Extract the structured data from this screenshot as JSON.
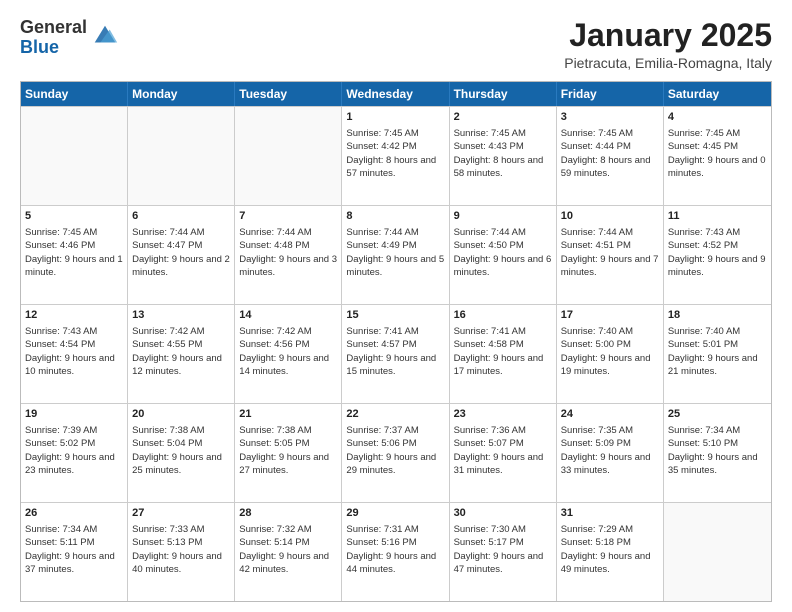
{
  "header": {
    "logo_general": "General",
    "logo_blue": "Blue",
    "title": "January 2025",
    "subtitle": "Pietracuta, Emilia-Romagna, Italy"
  },
  "weekdays": [
    "Sunday",
    "Monday",
    "Tuesday",
    "Wednesday",
    "Thursday",
    "Friday",
    "Saturday"
  ],
  "weeks": [
    [
      {
        "date": "",
        "info": ""
      },
      {
        "date": "",
        "info": ""
      },
      {
        "date": "",
        "info": ""
      },
      {
        "date": "1",
        "info": "Sunrise: 7:45 AM\nSunset: 4:42 PM\nDaylight: 8 hours and 57 minutes."
      },
      {
        "date": "2",
        "info": "Sunrise: 7:45 AM\nSunset: 4:43 PM\nDaylight: 8 hours and 58 minutes."
      },
      {
        "date": "3",
        "info": "Sunrise: 7:45 AM\nSunset: 4:44 PM\nDaylight: 8 hours and 59 minutes."
      },
      {
        "date": "4",
        "info": "Sunrise: 7:45 AM\nSunset: 4:45 PM\nDaylight: 9 hours and 0 minutes."
      }
    ],
    [
      {
        "date": "5",
        "info": "Sunrise: 7:45 AM\nSunset: 4:46 PM\nDaylight: 9 hours and 1 minute."
      },
      {
        "date": "6",
        "info": "Sunrise: 7:44 AM\nSunset: 4:47 PM\nDaylight: 9 hours and 2 minutes."
      },
      {
        "date": "7",
        "info": "Sunrise: 7:44 AM\nSunset: 4:48 PM\nDaylight: 9 hours and 3 minutes."
      },
      {
        "date": "8",
        "info": "Sunrise: 7:44 AM\nSunset: 4:49 PM\nDaylight: 9 hours and 5 minutes."
      },
      {
        "date": "9",
        "info": "Sunrise: 7:44 AM\nSunset: 4:50 PM\nDaylight: 9 hours and 6 minutes."
      },
      {
        "date": "10",
        "info": "Sunrise: 7:44 AM\nSunset: 4:51 PM\nDaylight: 9 hours and 7 minutes."
      },
      {
        "date": "11",
        "info": "Sunrise: 7:43 AM\nSunset: 4:52 PM\nDaylight: 9 hours and 9 minutes."
      }
    ],
    [
      {
        "date": "12",
        "info": "Sunrise: 7:43 AM\nSunset: 4:54 PM\nDaylight: 9 hours and 10 minutes."
      },
      {
        "date": "13",
        "info": "Sunrise: 7:42 AM\nSunset: 4:55 PM\nDaylight: 9 hours and 12 minutes."
      },
      {
        "date": "14",
        "info": "Sunrise: 7:42 AM\nSunset: 4:56 PM\nDaylight: 9 hours and 14 minutes."
      },
      {
        "date": "15",
        "info": "Sunrise: 7:41 AM\nSunset: 4:57 PM\nDaylight: 9 hours and 15 minutes."
      },
      {
        "date": "16",
        "info": "Sunrise: 7:41 AM\nSunset: 4:58 PM\nDaylight: 9 hours and 17 minutes."
      },
      {
        "date": "17",
        "info": "Sunrise: 7:40 AM\nSunset: 5:00 PM\nDaylight: 9 hours and 19 minutes."
      },
      {
        "date": "18",
        "info": "Sunrise: 7:40 AM\nSunset: 5:01 PM\nDaylight: 9 hours and 21 minutes."
      }
    ],
    [
      {
        "date": "19",
        "info": "Sunrise: 7:39 AM\nSunset: 5:02 PM\nDaylight: 9 hours and 23 minutes."
      },
      {
        "date": "20",
        "info": "Sunrise: 7:38 AM\nSunset: 5:04 PM\nDaylight: 9 hours and 25 minutes."
      },
      {
        "date": "21",
        "info": "Sunrise: 7:38 AM\nSunset: 5:05 PM\nDaylight: 9 hours and 27 minutes."
      },
      {
        "date": "22",
        "info": "Sunrise: 7:37 AM\nSunset: 5:06 PM\nDaylight: 9 hours and 29 minutes."
      },
      {
        "date": "23",
        "info": "Sunrise: 7:36 AM\nSunset: 5:07 PM\nDaylight: 9 hours and 31 minutes."
      },
      {
        "date": "24",
        "info": "Sunrise: 7:35 AM\nSunset: 5:09 PM\nDaylight: 9 hours and 33 minutes."
      },
      {
        "date": "25",
        "info": "Sunrise: 7:34 AM\nSunset: 5:10 PM\nDaylight: 9 hours and 35 minutes."
      }
    ],
    [
      {
        "date": "26",
        "info": "Sunrise: 7:34 AM\nSunset: 5:11 PM\nDaylight: 9 hours and 37 minutes."
      },
      {
        "date": "27",
        "info": "Sunrise: 7:33 AM\nSunset: 5:13 PM\nDaylight: 9 hours and 40 minutes."
      },
      {
        "date": "28",
        "info": "Sunrise: 7:32 AM\nSunset: 5:14 PM\nDaylight: 9 hours and 42 minutes."
      },
      {
        "date": "29",
        "info": "Sunrise: 7:31 AM\nSunset: 5:16 PM\nDaylight: 9 hours and 44 minutes."
      },
      {
        "date": "30",
        "info": "Sunrise: 7:30 AM\nSunset: 5:17 PM\nDaylight: 9 hours and 47 minutes."
      },
      {
        "date": "31",
        "info": "Sunrise: 7:29 AM\nSunset: 5:18 PM\nDaylight: 9 hours and 49 minutes."
      },
      {
        "date": "",
        "info": ""
      }
    ]
  ]
}
